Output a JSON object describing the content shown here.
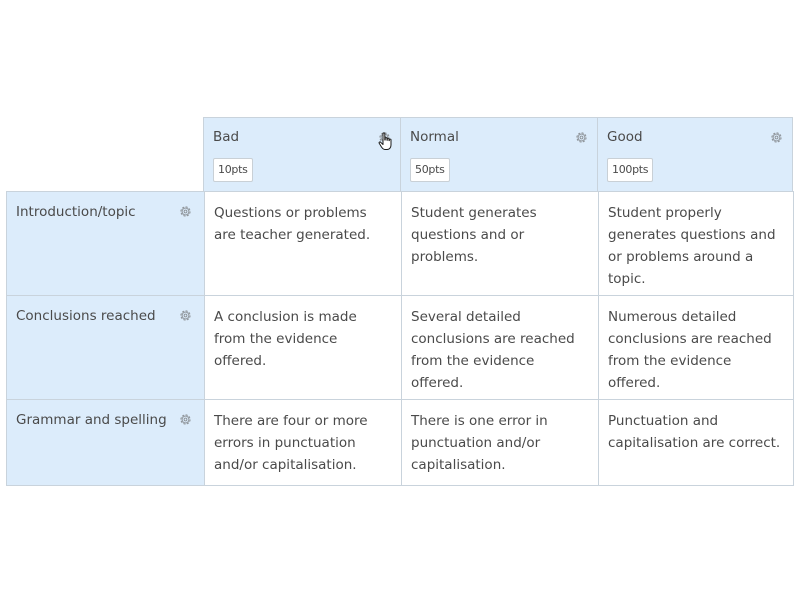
{
  "levels": [
    {
      "name": "Bad",
      "points": "10pts"
    },
    {
      "name": "Normal",
      "points": "50pts"
    },
    {
      "name": "Good",
      "points": "100pts"
    }
  ],
  "criteria": [
    {
      "name": "Introduction/topic",
      "descriptions": [
        "Questions or problems are teacher generated.",
        "Student generates questions and or problems.",
        "Student properly generates questions and or problems around a topic."
      ]
    },
    {
      "name": "Conclusions reached",
      "descriptions": [
        "A conclusion is made from the evidence offered.",
        "Several detailed conclusions are reached from the evidence offered.",
        "Numerous detailed conclusions are reached from the evidence offered."
      ]
    },
    {
      "name": "Grammar and spelling",
      "descriptions": [
        "There are four or more errors in punctuation and/or capitalisation.",
        "There is one error in punctuation and/or capitalisation.",
        "Punctuation and capitalisation are correct."
      ]
    }
  ],
  "icons": {
    "settings": "gear-icon",
    "pointer": "hand-pointer-icon"
  },
  "colors": {
    "header_bg": "#dcecfb",
    "border": "#c9d3dc",
    "text": "#4a4a4a"
  }
}
